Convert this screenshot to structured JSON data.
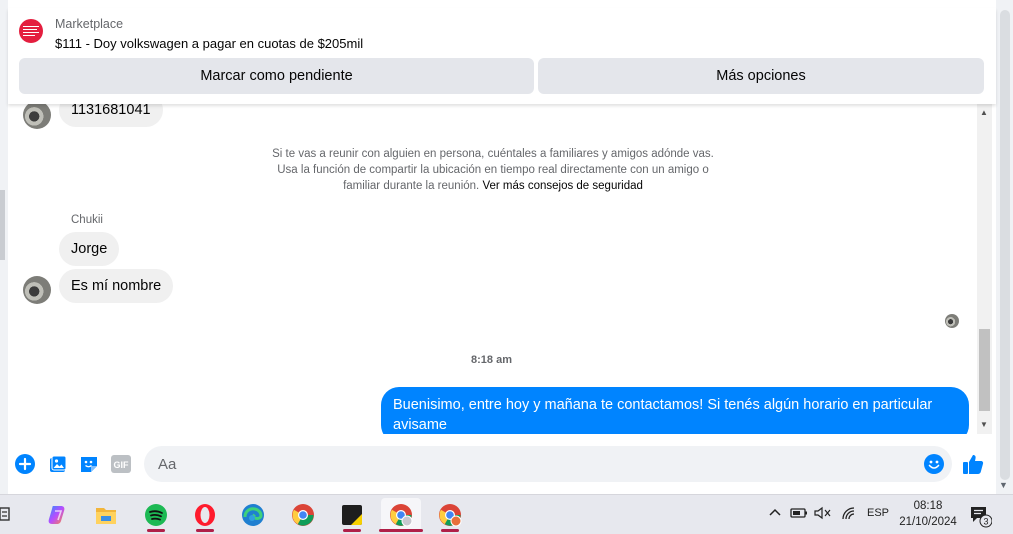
{
  "header": {
    "category": "Marketplace",
    "listing_title": "$111 - Doy volkswagen a pagar en cuotas de $205mil",
    "mark_pending_label": "Marcar como pendiente",
    "more_options_label": "Más opciones"
  },
  "conversation": {
    "messages": [
      {
        "text": "1131681041"
      },
      {
        "text": "Jorge"
      },
      {
        "text": "Es mí nombre"
      },
      {
        "text": "Buenisimo, entre hoy y mañana te contactamos! Si tenés algún horario en particular avisame"
      }
    ],
    "safety_text": "Si te vas a reunir con alguien en persona, cuéntales a familiares y amigos adónde vas. Usa la función de compartir la ubicación en tiempo real directamente con un amigo o familiar durante la reunión.",
    "safety_link": "Ver más consejos de seguridad",
    "sender_name": "Chukii",
    "timestamp": "8:18 am"
  },
  "composer": {
    "placeholder": "Aa",
    "gif_label": "GIF",
    "icons": [
      "plus-circle-icon",
      "photo-icon",
      "sticker-icon",
      "gif-icon",
      "emoji-icon",
      "thumbs-up-icon"
    ]
  },
  "colors": {
    "accent": "#0084ff",
    "incoming_bubble": "#f0f0f0",
    "header_button": "#e4e6eb"
  },
  "taskbar": {
    "apps": [
      "copilot-icon",
      "file-explorer-icon",
      "spotify-icon",
      "opera-icon",
      "edge-icon",
      "chrome-icon",
      "sticky-notes-icon",
      "chrome-profile-1-icon",
      "chrome-profile-2-icon"
    ],
    "language": "ESP",
    "time": "08:18",
    "date": "21/10/2024",
    "notification_count": "3"
  }
}
